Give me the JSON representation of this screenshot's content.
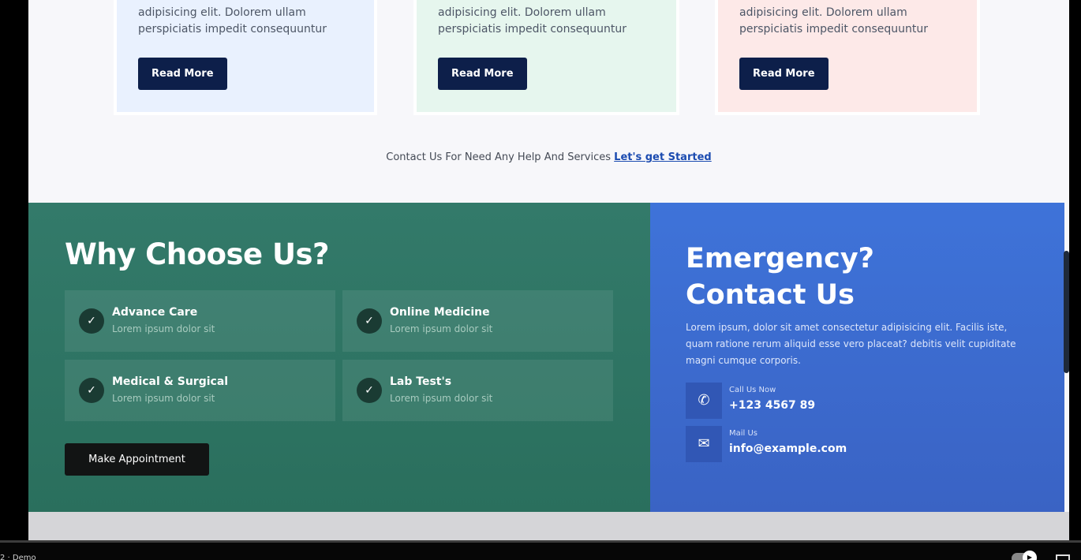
{
  "cards": [
    {
      "text": "adipisicing elit. Dolorem ullam perspiciatis impedit consequuntur",
      "button": "Read More"
    },
    {
      "text": "adipisicing elit. Dolorem ullam perspiciatis impedit consequuntur",
      "button": "Read More"
    },
    {
      "text": "adipisicing elit. Dolorem ullam perspiciatis impedit consequuntur",
      "button": "Read More"
    }
  ],
  "contact_line": {
    "text": "Contact Us For Need Any Help And Services",
    "link": "Let's get Started"
  },
  "why": {
    "title": "Why Choose Us?",
    "features": [
      {
        "title": "Advance Care",
        "subtitle": "Lorem ipsum dolor sit"
      },
      {
        "title": "Online Medicine",
        "subtitle": "Lorem ipsum dolor sit"
      },
      {
        "title": "Medical & Surgical",
        "subtitle": "Lorem ipsum dolor sit"
      },
      {
        "title": "Lab Test's",
        "subtitle": "Lorem ipsum dolor sit"
      }
    ],
    "button": "Make Appointment"
  },
  "emergency": {
    "title_line1": "Emergency?",
    "title_line2": "Contact Us",
    "text": "Lorem ipsum, dolor sit amet consectetur adipisicing elit. Facilis iste, quam ratione rerum aliquid esse vero placeat? debitis velit cupiditate magni cumque corporis.",
    "phone_label": "Call Us Now",
    "phone": "+123 4567 89",
    "mail_label": "Mail Us",
    "mail": "info@example.com"
  },
  "player": {
    "breadcrumb": "2 · Demo"
  },
  "icons": {
    "check": "check-icon",
    "phone": "phone-icon",
    "mail": "mail-icon"
  }
}
